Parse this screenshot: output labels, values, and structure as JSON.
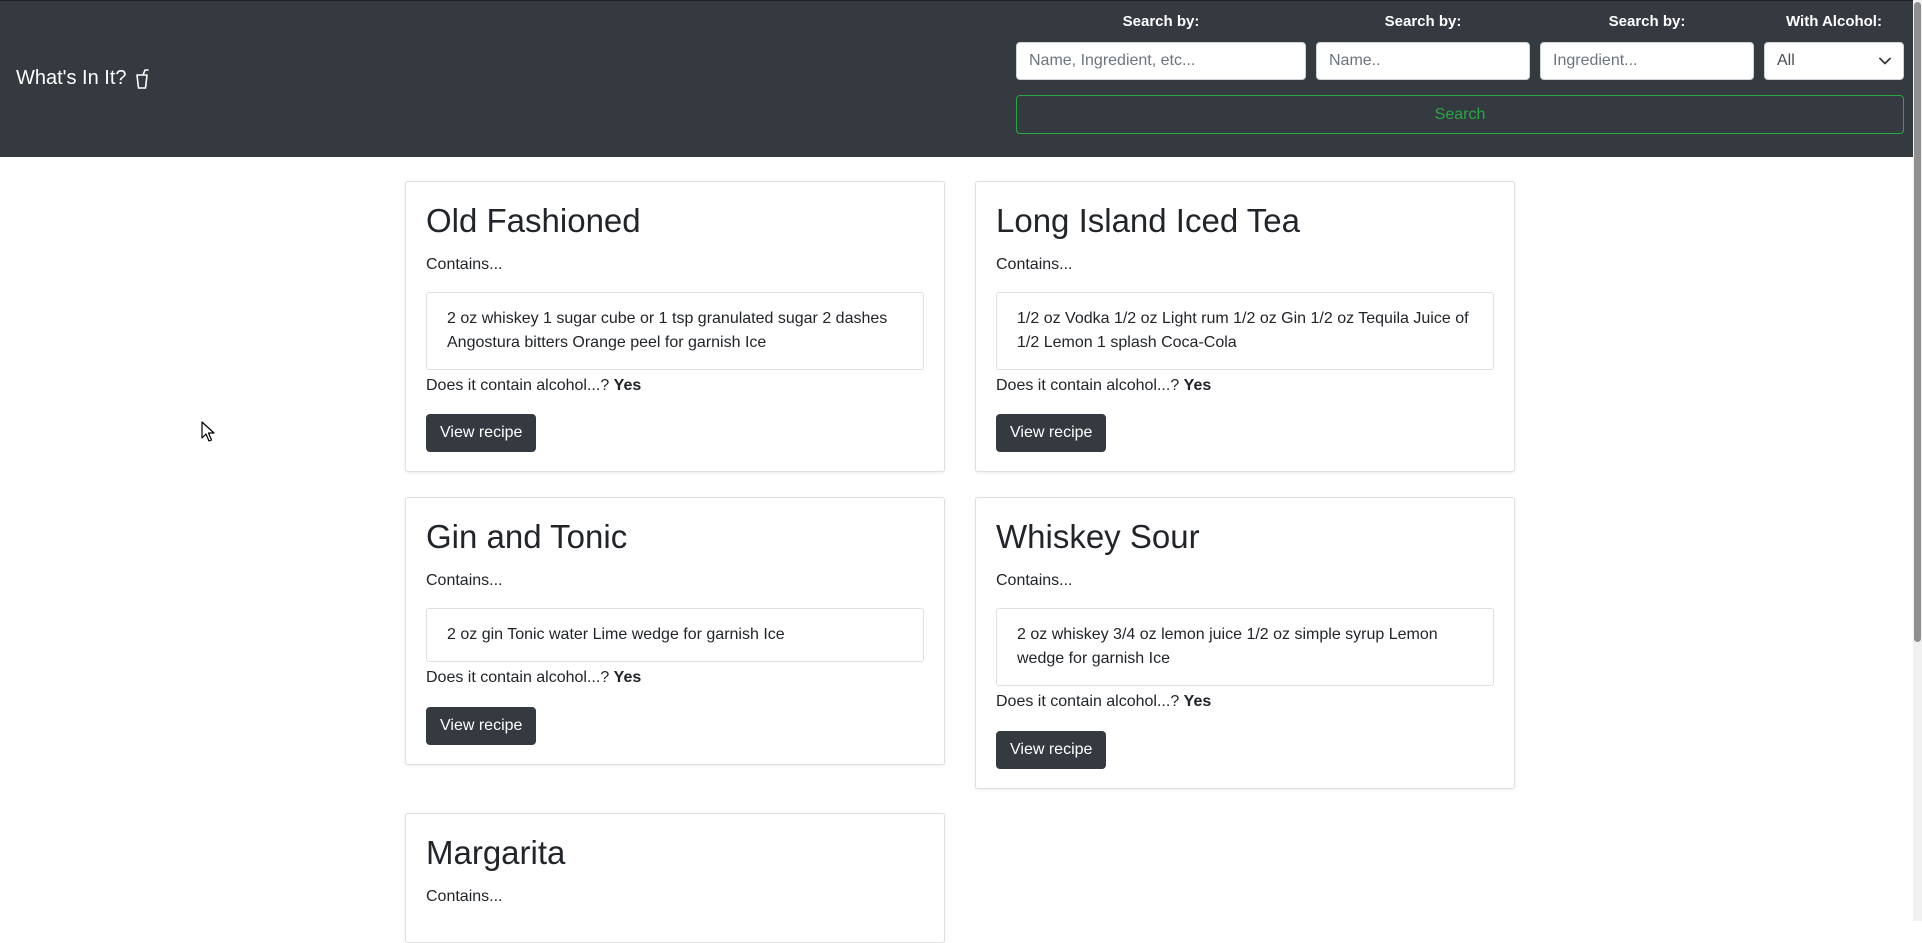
{
  "app": {
    "brand": "What's In It?",
    "brand_icon": "cup-straw-icon"
  },
  "search": {
    "general_label": "Search by:",
    "general_placeholder": "Name, Ingredient, etc...",
    "name_label": "Search by:",
    "name_placeholder": "Name..",
    "ingredient_label": "Search by:",
    "ingredient_placeholder": "Ingredient...",
    "alcohol_label": "With Alcohol:",
    "alcohol_selected": "All",
    "button_label": "Search"
  },
  "cards": [
    {
      "title": "Old Fashioned",
      "contains_label": "Contains...",
      "ingredients": "2 oz whiskey 1 sugar cube or 1 tsp granulated sugar 2 dashes Angostura bitters Orange peel for garnish Ice",
      "alcohol_question": "Does it contain alcohol...?",
      "alcohol_answer": "Yes",
      "button_label": "View recipe"
    },
    {
      "title": "Long Island Iced Tea",
      "contains_label": "Contains...",
      "ingredients": "1/2 oz Vodka 1/2 oz Light rum 1/2 oz Gin 1/2 oz Tequila Juice of 1/2 Lemon 1 splash Coca-Cola",
      "alcohol_question": "Does it contain alcohol...?",
      "alcohol_answer": "Yes",
      "button_label": "View recipe"
    },
    {
      "title": "Gin and Tonic",
      "contains_label": "Contains...",
      "ingredients": "2 oz gin Tonic water Lime wedge for garnish Ice",
      "alcohol_question": "Does it contain alcohol...?",
      "alcohol_answer": "Yes",
      "button_label": "View recipe"
    },
    {
      "title": "Whiskey Sour",
      "contains_label": "Contains...",
      "ingredients": "2 oz whiskey 3/4 oz lemon juice 1/2 oz simple syrup Lemon wedge for garnish Ice",
      "alcohol_question": "Does it contain alcohol...?",
      "alcohol_answer": "Yes",
      "button_label": "View recipe"
    },
    {
      "title": "Margarita",
      "contains_label": "Contains..."
    }
  ],
  "colors": {
    "navbar_bg": "#343a40",
    "search_button": "#28a745",
    "view_button_bg": "#343a40"
  }
}
